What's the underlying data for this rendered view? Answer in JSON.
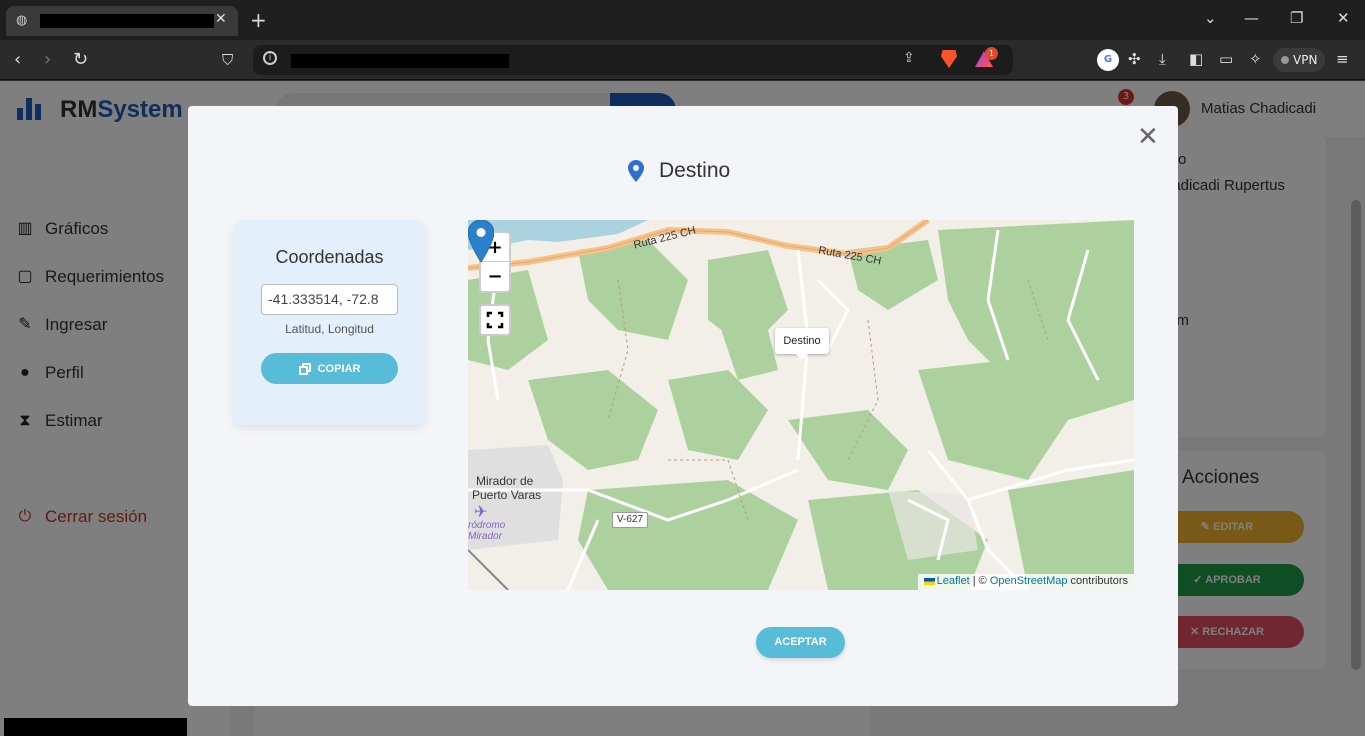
{
  "browser": {
    "window_controls": {
      "minimize": "—",
      "restore": "❐",
      "close": "✕"
    },
    "rewards_badge": "1",
    "vpn_label": "VPN"
  },
  "app": {
    "logo_prefix": "RM",
    "logo_suffix": "System",
    "notification_count": "3",
    "user_name": "Matias Chadicadi",
    "sidebar": [
      {
        "label": "Gráficos",
        "icon": "chart-icon"
      },
      {
        "label": "Requerimientos",
        "icon": "clipboard-icon"
      },
      {
        "label": "Ingresar",
        "icon": "pen-icon"
      },
      {
        "label": "Perfil",
        "icon": "user-icon"
      },
      {
        "label": "Estimar",
        "icon": "hourglass-icon"
      }
    ],
    "logout_label": "Cerrar sesión",
    "right_text_1": "o",
    "right_text_2": "hadicadi Rupertus",
    "right_text_3": "om",
    "acciones": {
      "title": "Acciones",
      "edit": "EDITAR",
      "approve": "APROBAR",
      "reject": "RECHAZAR",
      "colors": {
        "edit": "#f0b32a",
        "approve": "#1e9a4a",
        "reject": "#e34e5e"
      }
    }
  },
  "modal": {
    "title": "Destino",
    "close_glyph": "✕",
    "coords": {
      "title": "Coordenadas",
      "value": "-41.333514, -72.8",
      "hint": "Latitud, Longitud",
      "copy_label": "COPIAR"
    },
    "map": {
      "zoom_in": "+",
      "zoom_out": "−",
      "marker_tooltip": "Destino",
      "road_label_1": "Ruta 225 CH",
      "road_label_2": "Ruta 225 CH",
      "place_label_line1": "Mirador de",
      "place_label_line2": "Puerto Varas",
      "airfield_line1": "ródromo",
      "airfield_line2": "Mirador",
      "route_shield": "V-627",
      "attribution": {
        "leaflet": "Leaflet",
        "separator": " | © ",
        "osm": "OpenStreetMap",
        "contributors": " contributors"
      }
    },
    "accept_label": "ACEPTAR"
  }
}
